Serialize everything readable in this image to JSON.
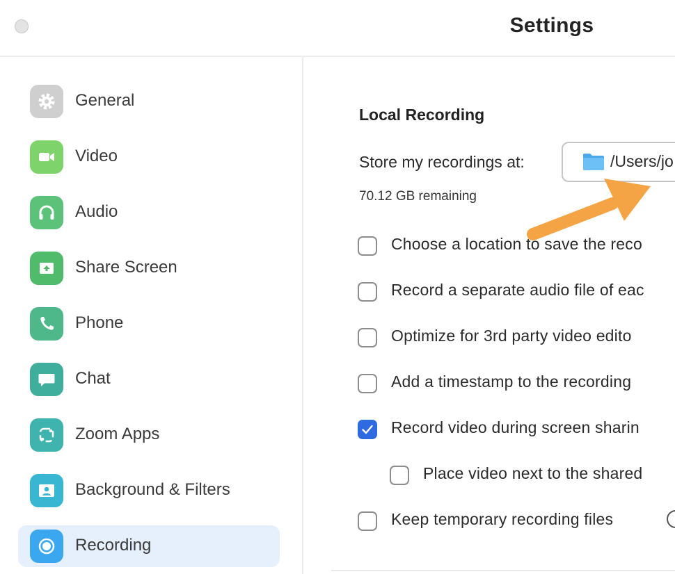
{
  "window": {
    "title": "Settings"
  },
  "colors": {
    "accent": "#2f6be0",
    "active_bg": "#e5f0fc",
    "annotation_arrow": "#f5a445"
  },
  "sidebar": {
    "items": [
      {
        "label": "General",
        "icon": "gear-icon",
        "color": "#cfcfcf"
      },
      {
        "label": "Video",
        "icon": "video-camera-icon",
        "color": "#7ed36a"
      },
      {
        "label": "Audio",
        "icon": "headphones-icon",
        "color": "#5cc27a"
      },
      {
        "label": "Share Screen",
        "icon": "share-screen-icon",
        "color": "#4fbb6b"
      },
      {
        "label": "Phone",
        "icon": "phone-icon",
        "color": "#4fb88a"
      },
      {
        "label": "Chat",
        "icon": "chat-bubble-icon",
        "color": "#3fae9c"
      },
      {
        "label": "Zoom Apps",
        "icon": "zoom-apps-icon",
        "color": "#3fb3ad"
      },
      {
        "label": "Background & Filters",
        "icon": "person-background-icon",
        "color": "#39b7d2"
      },
      {
        "label": "Recording",
        "icon": "record-icon",
        "color": "#3aa7ee",
        "active": true
      }
    ]
  },
  "main": {
    "section_title": "Local Recording",
    "store_label": "Store my recordings at:",
    "path": "/Users/jo",
    "remaining": "70.12 GB remaining",
    "options": [
      {
        "label": "Choose a location to save the reco",
        "checked": false
      },
      {
        "label": "Record a separate audio file of eac",
        "checked": false
      },
      {
        "label": "Optimize for 3rd party video edito",
        "checked": false
      },
      {
        "label": "Add a timestamp to the recording",
        "checked": false
      },
      {
        "label": "Record video during screen sharin",
        "checked": true
      },
      {
        "label": "Place video next to the shared",
        "checked": false,
        "indent": true
      },
      {
        "label": "Keep temporary recording files",
        "checked": false
      }
    ]
  }
}
